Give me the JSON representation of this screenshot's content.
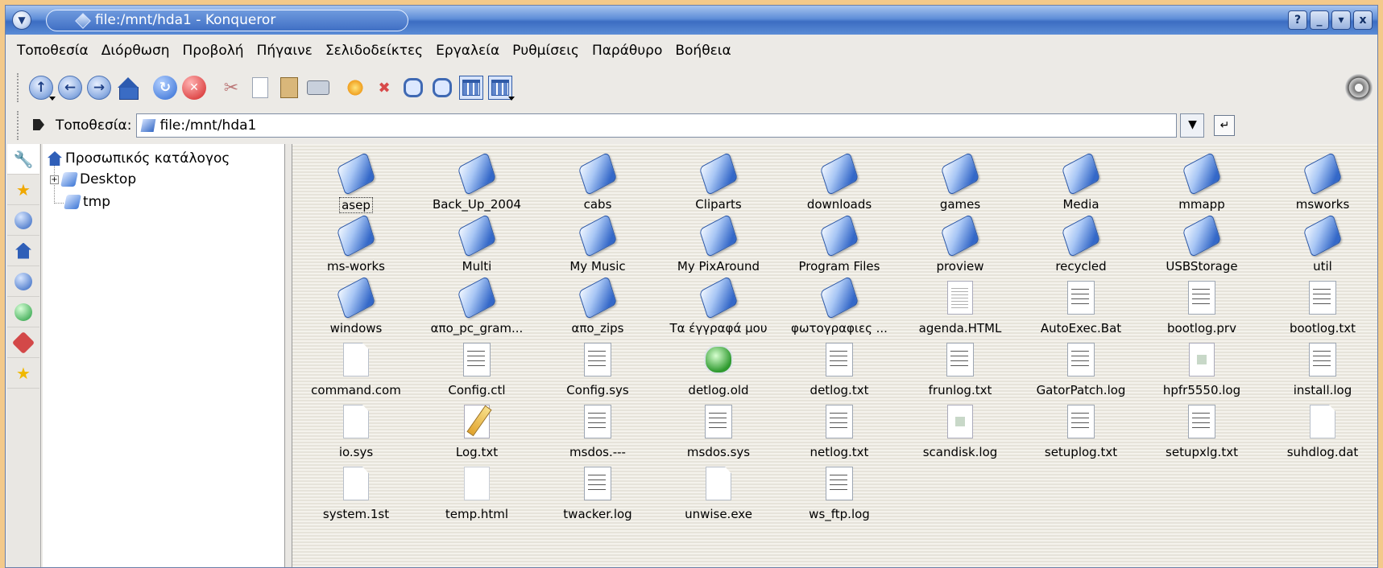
{
  "window": {
    "title": "file:/mnt/hda1 - Konqueror",
    "controls": [
      "?",
      "_",
      "▾",
      "x"
    ]
  },
  "menu": [
    "Τοποθεσία",
    "Διόρθωση",
    "Προβολή",
    "Πήγαινε",
    "Σελιδοδείκτες",
    "Εργαλεία",
    "Ρυθμίσεις",
    "Παράθυρο",
    "Βοήθεια"
  ],
  "toolbar": {
    "icons": [
      "up-icon",
      "back-icon",
      "forward-icon",
      "home-icon",
      "reload-icon",
      "stop-icon",
      "cut-icon",
      "copy-icon",
      "paste-icon",
      "print-icon",
      "new-folder-icon",
      "delete-icon",
      "zoom-in-icon",
      "zoom-out-icon",
      "icon-view-icon",
      "detail-view-icon",
      "settings-gear-icon"
    ]
  },
  "location": {
    "label": "Τοποθεσία:",
    "value": "file:/mnt/hda1"
  },
  "tree": {
    "root": "Προσωπικός κατάλογος",
    "children": [
      "Desktop",
      "tmp"
    ]
  },
  "files": [
    {
      "name": "asep",
      "type": "folder"
    },
    {
      "name": "Back_Up_2004",
      "type": "folder"
    },
    {
      "name": "cabs",
      "type": "folder"
    },
    {
      "name": "Cliparts",
      "type": "folder"
    },
    {
      "name": "downloads",
      "type": "folder"
    },
    {
      "name": "games",
      "type": "folder"
    },
    {
      "name": "Media",
      "type": "folder"
    },
    {
      "name": "mmapp",
      "type": "folder"
    },
    {
      "name": "msworks",
      "type": "folder"
    },
    {
      "name": "ms-works",
      "type": "folder"
    },
    {
      "name": "Multi",
      "type": "folder"
    },
    {
      "name": "My Music",
      "type": "folder"
    },
    {
      "name": "My PixAround",
      "type": "folder"
    },
    {
      "name": "Program Files",
      "type": "folder"
    },
    {
      "name": "proview",
      "type": "folder"
    },
    {
      "name": "recycled",
      "type": "folder"
    },
    {
      "name": "USBStorage",
      "type": "folder"
    },
    {
      "name": "util",
      "type": "folder"
    },
    {
      "name": "windows",
      "type": "folder"
    },
    {
      "name": "απο_pc_gram...",
      "type": "folder"
    },
    {
      "name": "απο_zips",
      "type": "folder"
    },
    {
      "name": "Τα έγγραφά μου",
      "type": "folder"
    },
    {
      "name": "φωτογραφιες ...",
      "type": "folder"
    },
    {
      "name": "agenda.HTML",
      "type": "html"
    },
    {
      "name": "AutoExec.Bat",
      "type": "txt"
    },
    {
      "name": "bootlog.prv",
      "type": "txt"
    },
    {
      "name": "bootlog.txt",
      "type": "txt"
    },
    {
      "name": "command.com",
      "type": "doc"
    },
    {
      "name": "Config.ctl",
      "type": "txt"
    },
    {
      "name": "Config.sys",
      "type": "txt"
    },
    {
      "name": "detlog.old",
      "type": "green"
    },
    {
      "name": "detlog.txt",
      "type": "txt"
    },
    {
      "name": "frunlog.txt",
      "type": "txt"
    },
    {
      "name": "GatorPatch.log",
      "type": "txt"
    },
    {
      "name": "hpfr5550.log",
      "type": "img"
    },
    {
      "name": "install.log",
      "type": "txt"
    },
    {
      "name": "io.sys",
      "type": "doc"
    },
    {
      "name": "Log.txt",
      "type": "pencil"
    },
    {
      "name": "msdos.---",
      "type": "txt"
    },
    {
      "name": "msdos.sys",
      "type": "txt"
    },
    {
      "name": "netlog.txt",
      "type": "txt"
    },
    {
      "name": "scandisk.log",
      "type": "img"
    },
    {
      "name": "setuplog.txt",
      "type": "txt"
    },
    {
      "name": "setupxlg.txt",
      "type": "txt"
    },
    {
      "name": "suhdlog.dat",
      "type": "doc"
    },
    {
      "name": "system.1st",
      "type": "doc"
    },
    {
      "name": "temp.html",
      "type": "blank"
    },
    {
      "name": "twacker.log",
      "type": "txt"
    },
    {
      "name": "unwise.exe",
      "type": "doc"
    },
    {
      "name": "ws_ftp.log",
      "type": "txt"
    }
  ]
}
